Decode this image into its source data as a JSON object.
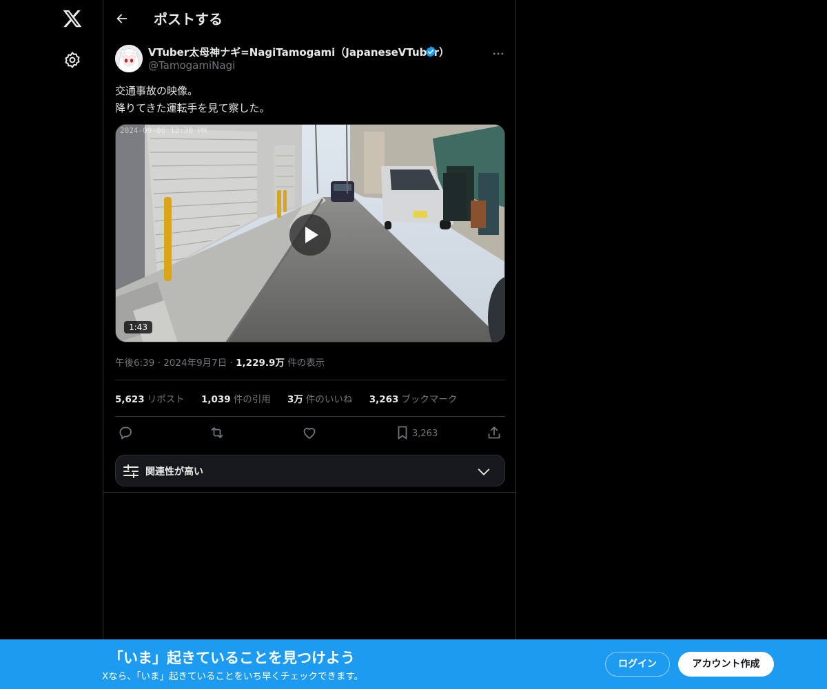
{
  "header": {
    "title": "ポストする"
  },
  "author": {
    "name": "VTuber太母神ナギ=NagiTamogami（JapaneseVTuber）",
    "handle": "@TamogamiNagi"
  },
  "post": {
    "lines": [
      "交通事故の映像。",
      "降りてきた運転手を見て察した。"
    ],
    "video": {
      "timestamp_overlay": "2024-09-06 12:30 PM",
      "duration": "1:43"
    }
  },
  "meta": {
    "time": "午後6:39",
    "date": "2024年9月7日",
    "views": "1,229.9万",
    "views_suffix": "件の表示"
  },
  "stats": {
    "reposts": {
      "num": "5,623",
      "label": "リポスト"
    },
    "quotes": {
      "num": "1,039",
      "label": "件の引用"
    },
    "likes": {
      "num": "3万",
      "label": "件のいいね"
    },
    "bookmarks": {
      "num": "3,263",
      "label": "ブックマーク"
    }
  },
  "actions": {
    "bookmark_count": "3,263"
  },
  "sort": {
    "label": "関連性が高い"
  },
  "banner": {
    "title": "「いま」起きていることを見つけよう",
    "subtitle": "Xなら、「いま」起きていることをいち早くチェックできます。",
    "login_label": "ログイン",
    "signup_label": "アカウント作成"
  },
  "colors": {
    "accent": "#1d9bf0",
    "verified": "#1d9bf0",
    "muted": "#71767b"
  },
  "icons": [
    "x-logo-icon",
    "gear-icon",
    "back-arrow-icon",
    "verified-badge-icon",
    "more-icon",
    "play-icon",
    "reply-icon",
    "repost-icon",
    "like-icon",
    "bookmark-icon",
    "share-icon",
    "filter-icon",
    "chevron-down-icon"
  ]
}
